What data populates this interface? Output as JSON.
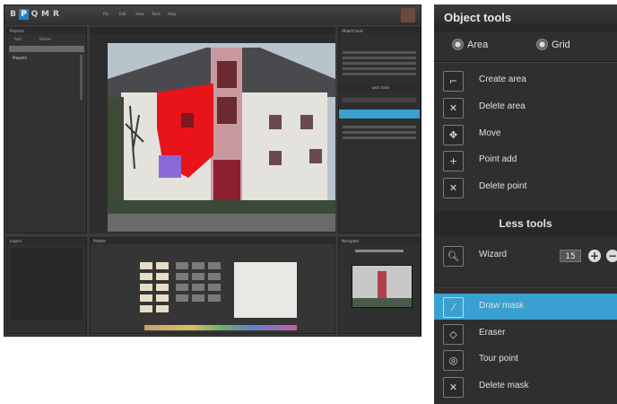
{
  "app": {
    "logo_letters": [
      "B",
      "P",
      "Q",
      "M",
      "R"
    ],
    "menu": [
      "File",
      "Edit",
      "View",
      "Tools",
      "Help"
    ],
    "left_panel_title": "Projects",
    "left_tabs": [
      "Add",
      "Delete"
    ],
    "project_item": "Project1",
    "right_panel_titles": [
      "Object tools",
      "Less tools"
    ],
    "layers_title": "Layers",
    "palette_title": "Palette",
    "navigator_title": "Navigator"
  },
  "tools_panel": {
    "header": "Object tools",
    "radio_area": "Area",
    "radio_grid": "Grid",
    "object_tools": [
      {
        "icon": "create-area-icon",
        "glyph": "⌐",
        "label": "Create area"
      },
      {
        "icon": "delete-area-icon",
        "glyph": "✕",
        "label": "Delete area"
      },
      {
        "icon": "move-icon",
        "glyph": "✥",
        "label": "Move"
      },
      {
        "icon": "point-add-icon",
        "glyph": "+",
        "label": "Point add"
      },
      {
        "icon": "delete-point-icon",
        "glyph": "✕",
        "label": "Delete point"
      }
    ],
    "less_tools_header": "Less tools",
    "wizard_label": "Wizard",
    "wizard_value": "15",
    "less_tools": [
      {
        "icon": "brush-icon",
        "glyph": "⁄",
        "label": "Draw mask",
        "active": true
      },
      {
        "icon": "eraser-icon",
        "glyph": "◇",
        "label": "Eraser",
        "active": false
      },
      {
        "icon": "touch-point-icon",
        "glyph": "◎",
        "label": "Tour point",
        "active": false
      },
      {
        "icon": "delete-mask-icon",
        "glyph": "✕",
        "label": "Delete mask",
        "active": false
      }
    ]
  },
  "colors": {
    "accent": "#3aa0d0",
    "mask": "#e8141a",
    "selection": "#8a6ad8"
  }
}
